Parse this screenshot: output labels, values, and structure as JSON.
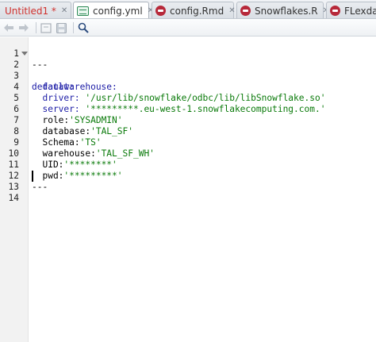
{
  "tabs": [
    {
      "label": "Untitled1 *",
      "icon": "r-script-icon",
      "dirty": true
    },
    {
      "label": "config.yml",
      "icon": "yaml-file-icon",
      "active": true
    },
    {
      "label": "config.Rmd",
      "icon": "rmd-icon"
    },
    {
      "label": "Snowflakes.R",
      "icon": "r-script-icon"
    },
    {
      "label": "FLexdas",
      "icon": "rmd-icon"
    }
  ],
  "toolbar": {
    "items": [
      "back-arrow-icon",
      "forward-arrow-icon",
      "show-in-window-icon",
      "save-icon",
      "find-icon"
    ]
  },
  "editor": {
    "lines": [
      {
        "n": "1",
        "text": "---",
        "style": "plain"
      },
      {
        "n": "2",
        "text": "default:",
        "style": "key",
        "fold": true
      },
      {
        "n": "3",
        "text": "  datawarehouse:",
        "style": "key"
      },
      {
        "n": "4",
        "text": "  driver: '/usr/lib/snowflake/odbc/lib/libSnowflake.so'",
        "style": "mixed",
        "key": "  driver: ",
        "value": "'/usr/lib/snowflake/odbc/lib/libSnowflake.so'"
      },
      {
        "n": "5",
        "text": "  server: '*********.eu-west-1.snowflakecomputing.com.'",
        "style": "mixed",
        "key": "  server: ",
        "value": "'*********.eu-west-1.snowflakecomputing.com.'"
      },
      {
        "n": "6",
        "text": "  role:'SYSADMIN'",
        "style": "mixed",
        "key": "  role:",
        "value": "'SYSADMIN'"
      },
      {
        "n": "7",
        "text": "  database:'TAL_SF'",
        "style": "mixed",
        "key": "  database:",
        "value": "'TAL_SF'"
      },
      {
        "n": "8",
        "text": "  Schema:'TS'",
        "style": "mixed",
        "key": "  Schema:",
        "value": "'TS'"
      },
      {
        "n": "9",
        "text": "  warehouse:'TAL_SF_WH'",
        "style": "mixed",
        "key": "  warehouse:",
        "value": "'TAL_SF_WH'"
      },
      {
        "n": "10",
        "text": "  UID:'********'",
        "style": "mixed",
        "key": "  UID:",
        "value": "'********'"
      },
      {
        "n": "11",
        "text": "  pwd:'*********'",
        "style": "mixed",
        "key": "  pwd:",
        "value": "'*********'"
      },
      {
        "n": "12",
        "text": "---",
        "style": "plain"
      },
      {
        "n": "13",
        "text": "",
        "style": "plain"
      },
      {
        "n": "14",
        "text": "",
        "style": "plain"
      }
    ],
    "cursor_line": 13
  },
  "colors": {
    "key": "#1c1ca6",
    "string": "#0a7a0a",
    "dirty_tab": "#d0312d"
  }
}
